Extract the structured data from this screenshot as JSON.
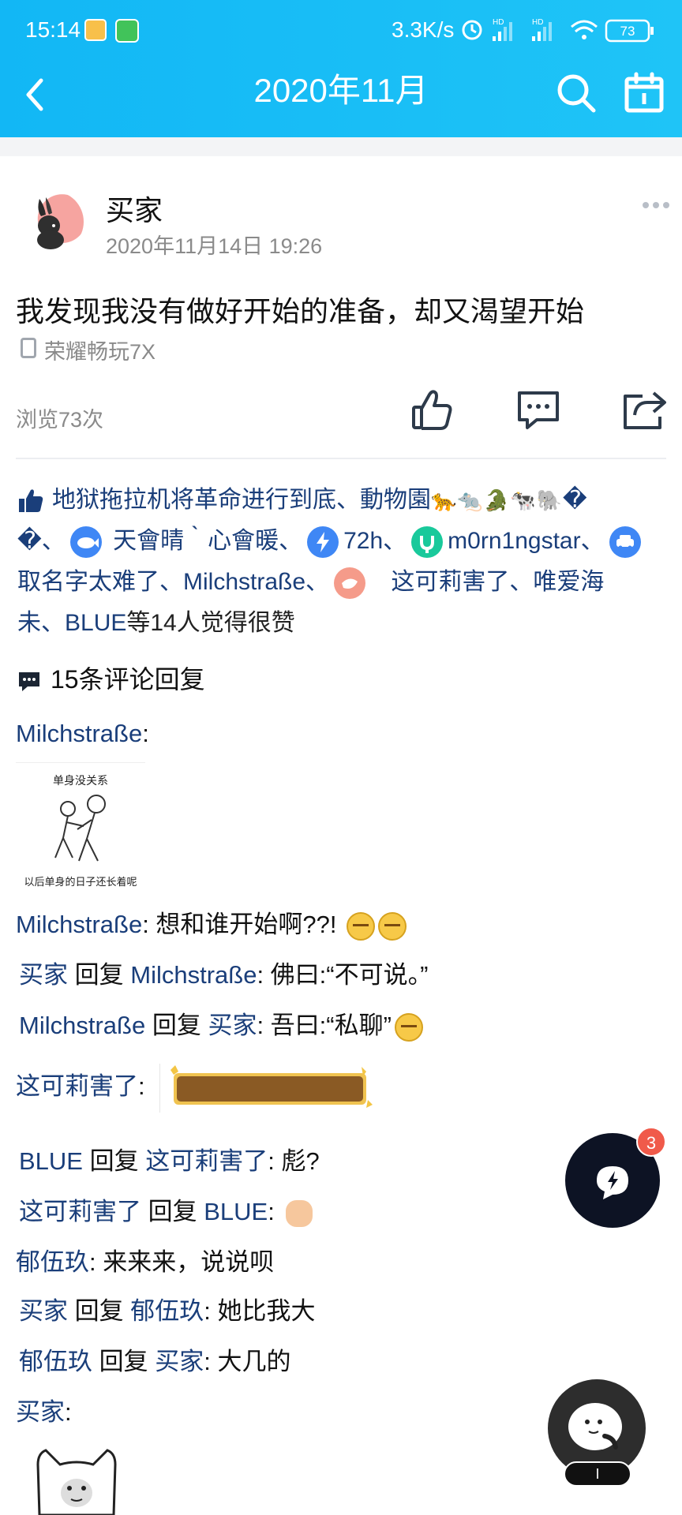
{
  "status_bar": {
    "time": "15:14",
    "net_speed": "3.3K/s",
    "network_labels": [
      "HD",
      "HD"
    ],
    "battery": "73"
  },
  "header": {
    "title": "2020年11月"
  },
  "post": {
    "author": "买家",
    "time": "2020年11月14日 19:26",
    "text": "我发现我没有做好开始的准备，却又渴望开始",
    "device": "荣耀畅玩7X",
    "views": "浏览73次"
  },
  "likes": {
    "line1_name": "地狱拖拉机将革命进行到底、動物園",
    "line1_emojis": "🐆🐀🐊🐄🐘",
    "line1_tail": "�",
    "line2_head": "�、",
    "name2": "天會晴｀心會暖、",
    "name3": "72h、",
    "name4": "m0rn1ngstar、",
    "name5": "取名字太难了、Milchstraße、",
    "name6": "这可莉害了、唯爱海",
    "name7": "未、BLUE",
    "suffix": "等14人觉得很赞"
  },
  "comments": {
    "title": "15条评论回复",
    "c1_name": "Milchstraße",
    "sticker_top": "单身没关系",
    "sticker_bottom": "以后单身的日子还长着呢",
    "c2_name": "Milchstraße",
    "c2_text": ": 想和谁开始啊??!",
    "c3_name": "买家",
    "c3_reply": "回复",
    "c3_target": "Milchstraße",
    "c3_text": ": 佛曰:“不可说。”",
    "c4_name": "Milchstraße",
    "c4_reply": "回复",
    "c4_target": "买家",
    "c4_text": ": 吾曰:“私聊”",
    "c5_name": "这可莉害了",
    "c6_name": "BLUE",
    "c6_reply": "回复",
    "c6_target": "这可莉害了",
    "c6_text": ": 彪?",
    "c7_name": "这可莉害了",
    "c7_reply": "回复",
    "c7_target": "BLUE",
    "c8_name": "郁伍玖",
    "c8_text": ": 来来来，说说呗",
    "c9_name": "买家",
    "c9_reply": "回复",
    "c9_target": "郁伍玖",
    "c9_text": ": 她比我大",
    "c10_name": "郁伍玖",
    "c10_reply": "回复",
    "c10_target": "买家",
    "c10_text": ": 大几的",
    "c11_name": "买家",
    "colon": ":"
  },
  "fab": {
    "badge": "3",
    "pill": "I"
  },
  "colors": {
    "header": "#12b7f5",
    "name_link": "#1a3e7a",
    "badge": "#f05a4a"
  }
}
